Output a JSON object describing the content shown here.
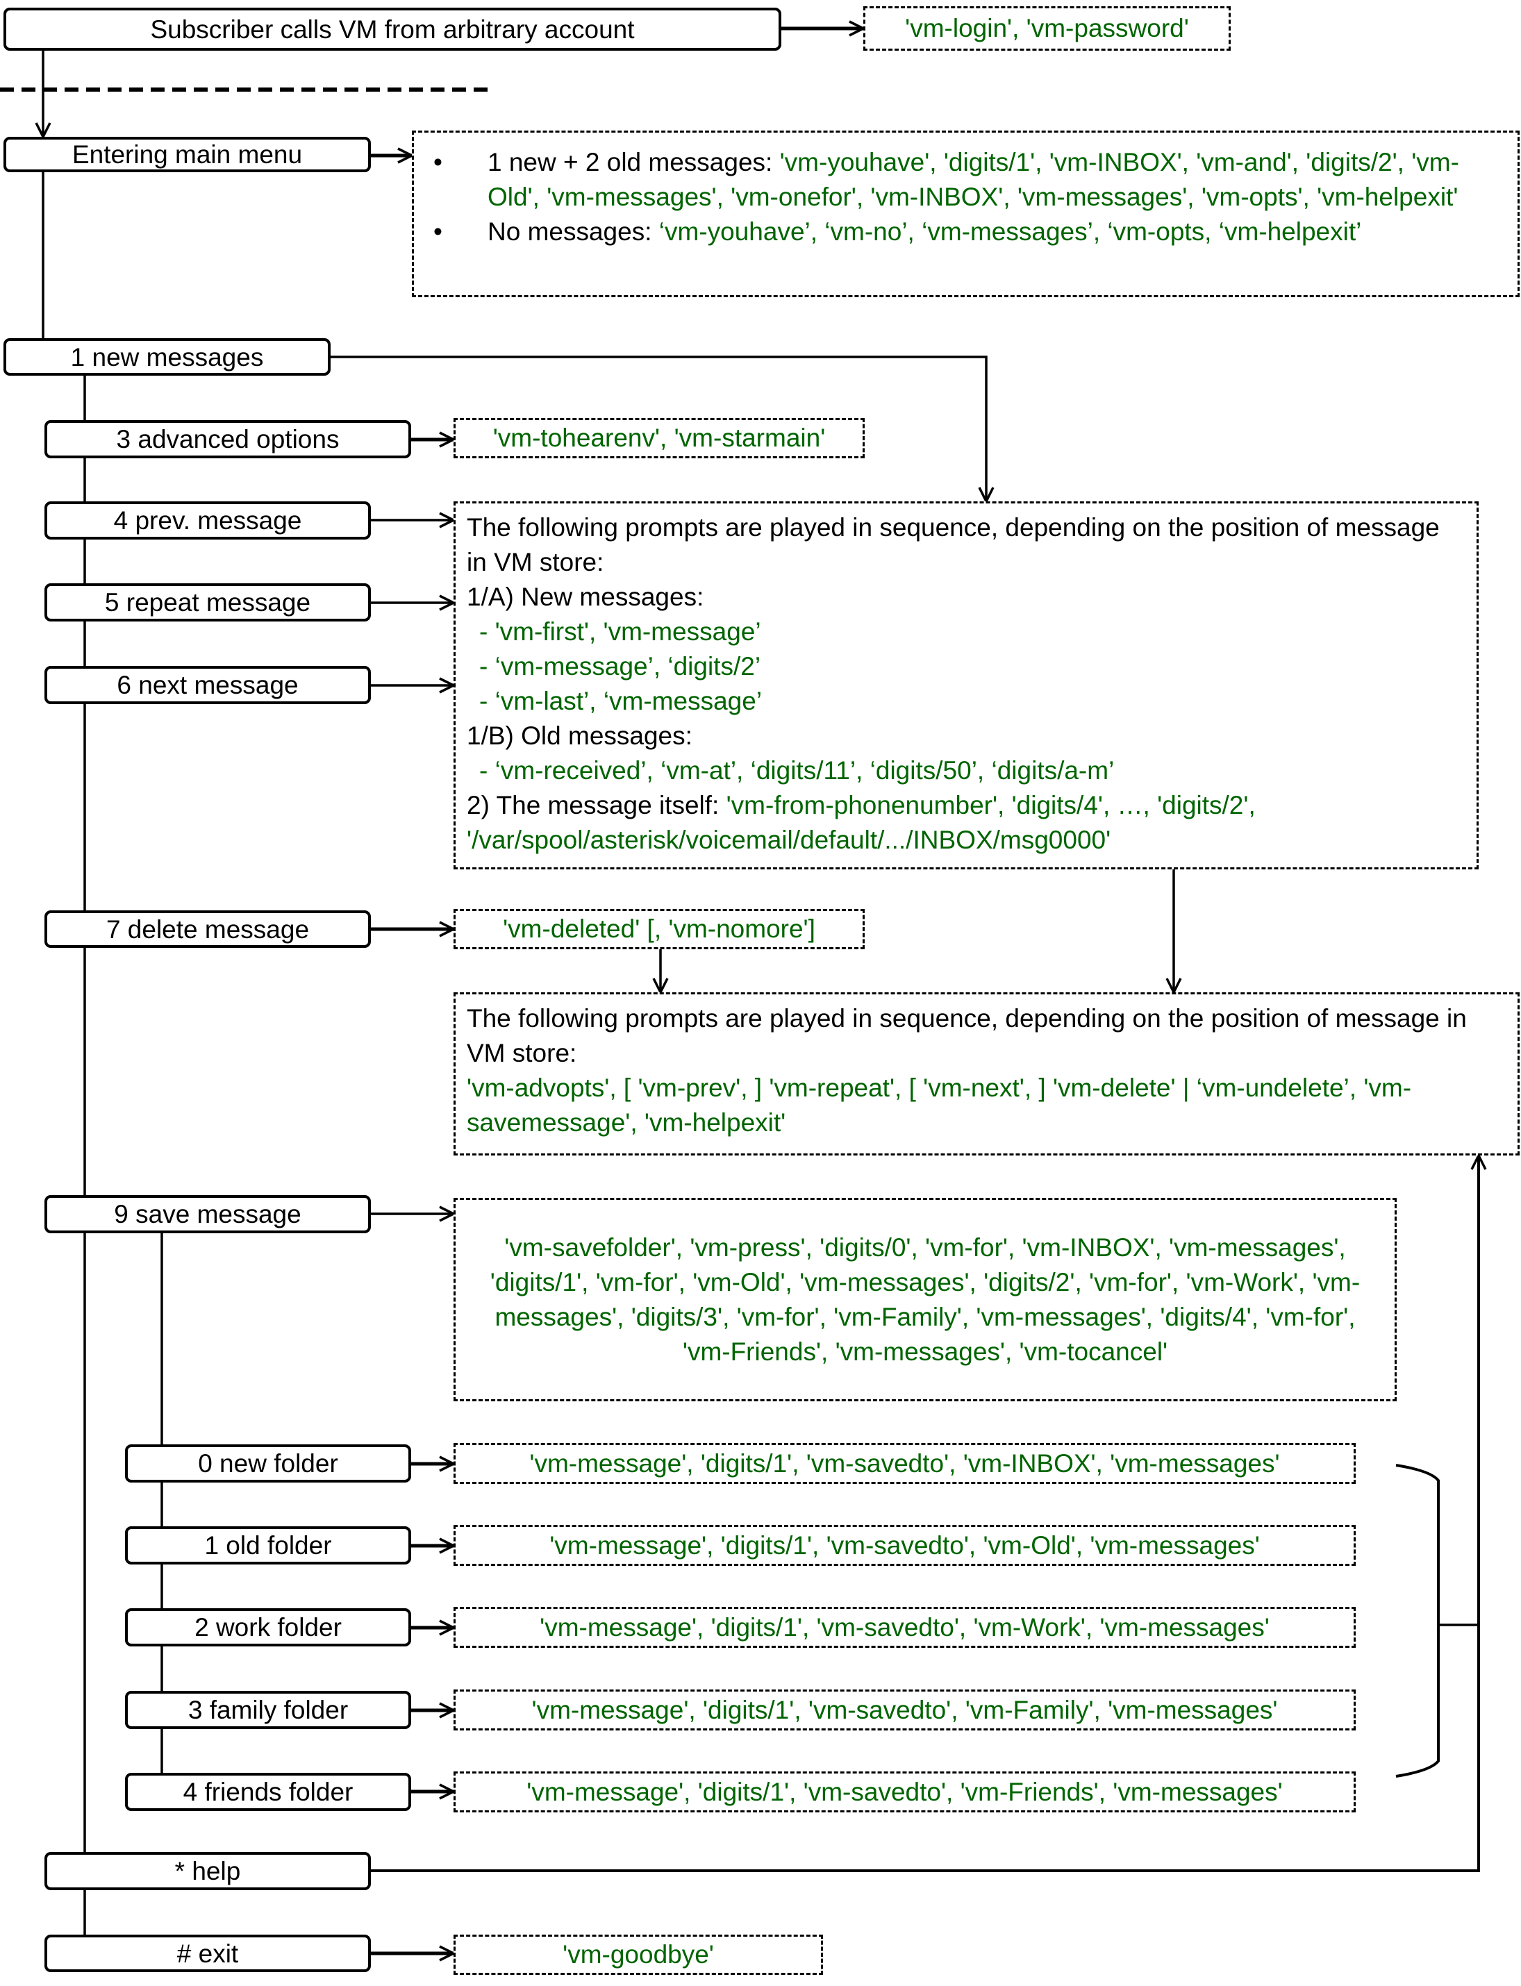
{
  "colors": {
    "prompt_text": "#006400",
    "line": "#000000"
  },
  "start": {
    "label": "Subscriber calls VM from arbitrary account",
    "prompts": "'vm-login', 'vm-password'"
  },
  "main_menu": {
    "label": "Entering main menu",
    "cases": [
      {
        "label": "1 new + 2 old messages: ",
        "prompts": "'vm-youhave', 'digits/1', 'vm-INBOX', 'vm-and', 'digits/2', 'vm-Old', 'vm-messages', 'vm-onefor', 'vm-INBOX', 'vm-messages', 'vm-opts', 'vm-helpexit'"
      },
      {
        "label": "No messages: ",
        "prompts": "‘vm-youhave’, ‘vm-no’, ‘vm-messages’, ‘vm-opts, ‘vm-helpexit’"
      }
    ]
  },
  "menu": {
    "new_messages": "1 new messages",
    "advanced_options": {
      "label": "3 advanced options",
      "prompts": "'vm-tohearenv', 'vm-starmain'"
    },
    "prev_message": "4 prev. message",
    "repeat_message": "5 repeat message",
    "next_message": "6 next message",
    "delete_message": {
      "label": "7 delete message",
      "prompts": "'vm-deleted' [, 'vm-nomore']"
    },
    "save_message": {
      "label": "9 save message",
      "prompts": "'vm-savefolder', 'vm-press', 'digits/0', 'vm-for', 'vm-INBOX', 'vm-messages', 'digits/1', 'vm-for', 'vm-Old', 'vm-messages', 'digits/2', 'vm-for', 'vm-Work', 'vm-messages', 'digits/3', 'vm-for', 'vm-Family', 'vm-messages', 'digits/4', 'vm-for', 'vm-Friends', 'vm-messages', 'vm-tocancel'"
    },
    "folders": [
      {
        "label": "0 new folder",
        "prompts": "'vm-message', 'digits/1', 'vm-savedto', 'vm-INBOX', 'vm-messages'"
      },
      {
        "label": "1 old folder",
        "prompts": "'vm-message', 'digits/1', 'vm-savedto', 'vm-Old', 'vm-messages'"
      },
      {
        "label": "2 work folder",
        "prompts": "'vm-message', 'digits/1', 'vm-savedto', 'vm-Work', 'vm-messages'"
      },
      {
        "label": "3 family folder",
        "prompts": "'vm-message', 'digits/1', 'vm-savedto', 'vm-Family', 'vm-messages'"
      },
      {
        "label": "4 friends folder",
        "prompts": "'vm-message', 'digits/1', 'vm-savedto', 'vm-Friends', 'vm-messages'"
      }
    ],
    "help": "* help",
    "exit": {
      "label": "# exit",
      "prompts": "'vm-goodbye'"
    }
  },
  "message_playback": {
    "intro": "The following prompts are played in sequence, depending on the position of message in VM store:",
    "new_heading": "1/A) New messages:",
    "new_items": [
      "- 'vm-first', 'vm-message’",
      "- ‘vm-message’, ‘digits/2’",
      "- ‘vm-last’, ‘vm-message’"
    ],
    "old_heading": "1/B) Old messages:",
    "old_items": [
      "- ‘vm-received’, ‘vm-at’, ‘digits/11’, ‘digits/50’, ‘digits/a-m’"
    ],
    "itself_label": "2) The message itself: ",
    "itself_prompts": "'vm-from-phonenumber', 'digits/4', …, 'digits/2', '/var/spool/asterisk/voicemail/default/.../INBOX/msg0000'"
  },
  "message_options": {
    "intro": "The following prompts are played in sequence, depending on the position of message in VM store:",
    "prompts": "'vm-advopts', [ 'vm-prev', ] 'vm-repeat', [ 'vm-next', ] 'vm-delete' | ‘vm-undelete’, 'vm-savemessage', 'vm-helpexit'"
  }
}
